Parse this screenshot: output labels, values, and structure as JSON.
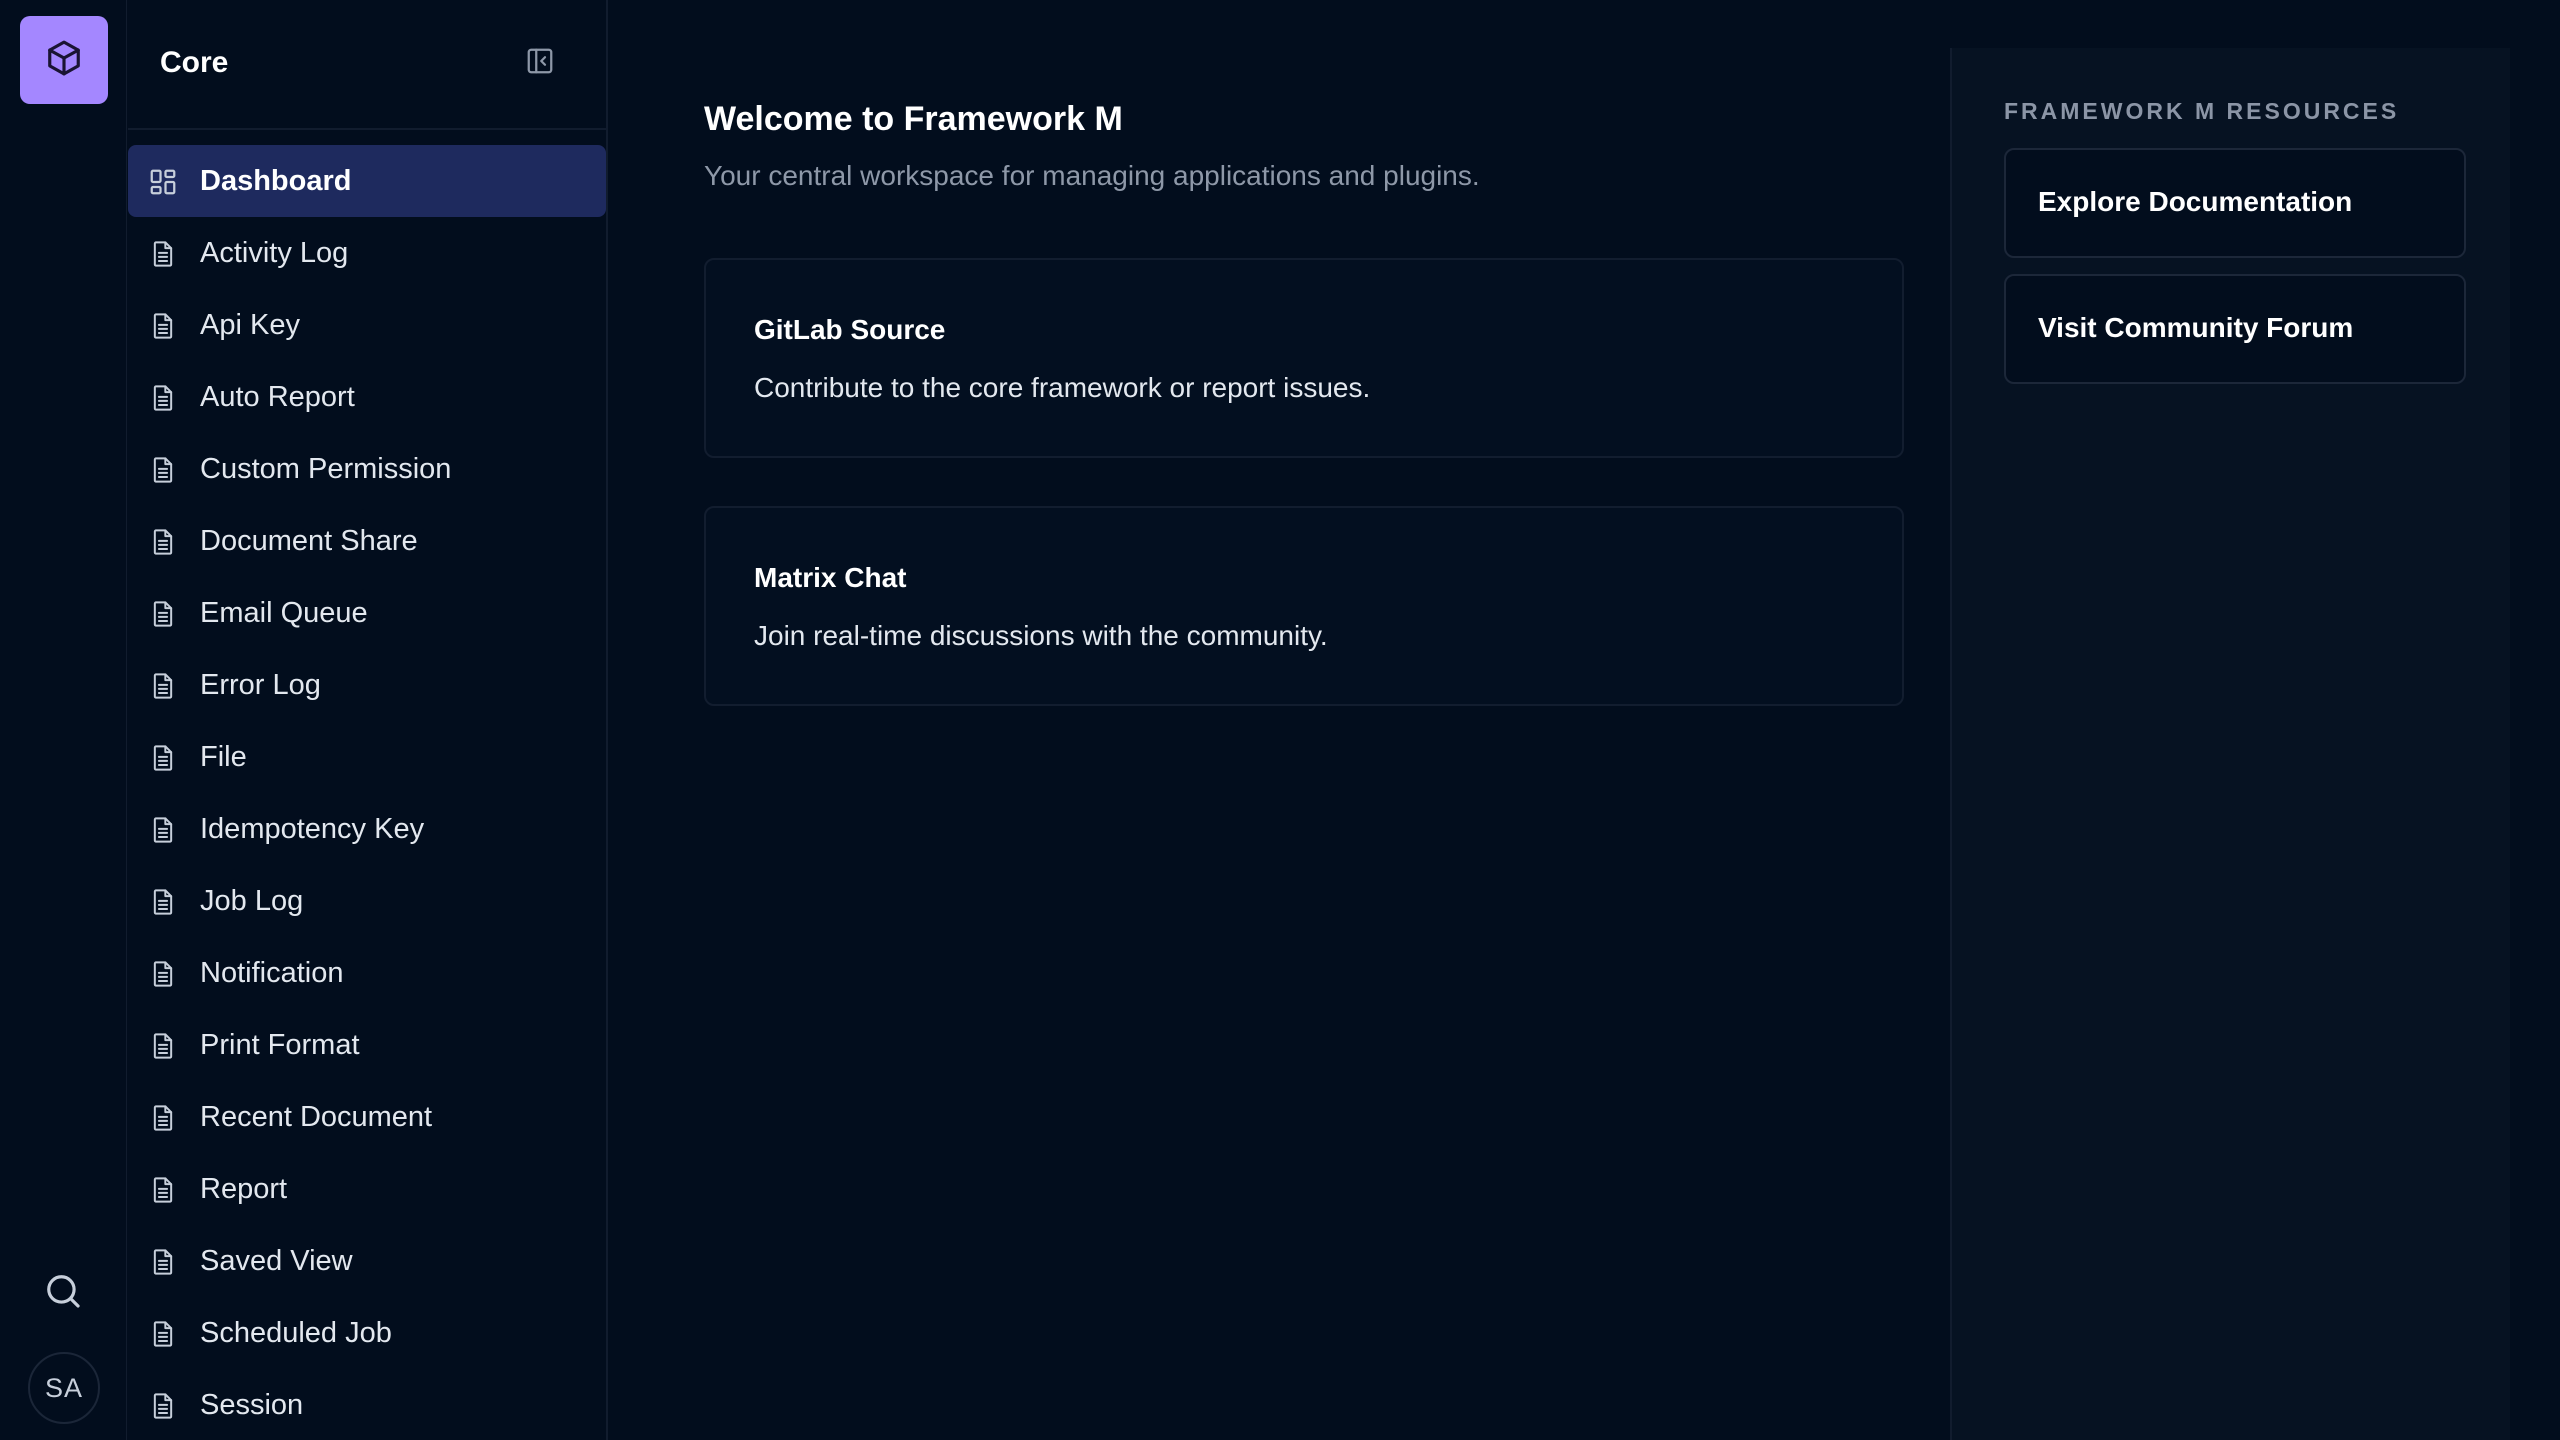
{
  "rail": {
    "logo_icon": "cube-icon",
    "search_icon": "search-icon",
    "avatar_initials": "SA"
  },
  "sidebar": {
    "title": "Core",
    "collapse_icon": "sidebar-collapse-icon",
    "items": [
      {
        "label": "Dashboard",
        "icon": "dashboard-icon",
        "active": true
      },
      {
        "label": "Activity Log",
        "icon": "document-icon"
      },
      {
        "label": "Api Key",
        "icon": "document-icon"
      },
      {
        "label": "Auto Report",
        "icon": "document-icon"
      },
      {
        "label": "Custom Permission",
        "icon": "document-icon"
      },
      {
        "label": "Document Share",
        "icon": "document-icon"
      },
      {
        "label": "Email Queue",
        "icon": "document-icon"
      },
      {
        "label": "Error Log",
        "icon": "document-icon"
      },
      {
        "label": "File",
        "icon": "document-icon"
      },
      {
        "label": "Idempotency Key",
        "icon": "document-icon"
      },
      {
        "label": "Job Log",
        "icon": "document-icon"
      },
      {
        "label": "Notification",
        "icon": "document-icon"
      },
      {
        "label": "Print Format",
        "icon": "document-icon"
      },
      {
        "label": "Recent Document",
        "icon": "document-icon"
      },
      {
        "label": "Report",
        "icon": "document-icon"
      },
      {
        "label": "Saved View",
        "icon": "document-icon"
      },
      {
        "label": "Scheduled Job",
        "icon": "document-icon"
      },
      {
        "label": "Session",
        "icon": "document-icon"
      }
    ]
  },
  "main": {
    "title": "Welcome to Framework M",
    "subtitle": "Your central workspace for managing applications and plugins.",
    "cards": [
      {
        "title": "GitLab Source",
        "description": "Contribute to the core framework or report issues."
      },
      {
        "title": "Matrix Chat",
        "description": "Join real-time discussions with the community."
      }
    ]
  },
  "resources": {
    "heading": "FRAMEWORK M RESOURCES",
    "links": [
      {
        "label": "Explore Documentation"
      },
      {
        "label": "Visit Community Forum"
      }
    ]
  },
  "colors": {
    "background": "#020d1d",
    "accent": "#a487ff",
    "active_item": "#1e2a5e",
    "muted_text": "#8e98a8",
    "border": "#111c2e"
  }
}
